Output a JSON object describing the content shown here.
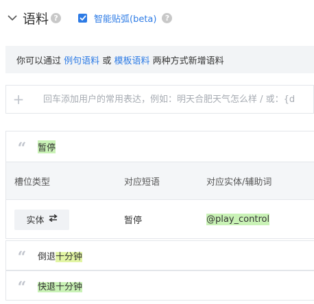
{
  "header": {
    "title": "语料",
    "smart_arc_label": "智能贴弧(beta)",
    "smart_arc_checked": true
  },
  "info": {
    "prefix": "你可以通过",
    "link1": "例句语料",
    "mid": "或",
    "link2": "模板语料",
    "suffix": "两种方式新增语料"
  },
  "add_input": {
    "placeholder": "回车添加用户的常用表达，例如：明天合肥天气怎么样 / 或：{d",
    "value": ""
  },
  "expanded_example": {
    "phrase": "暂停",
    "columns": [
      "槽位类型",
      "对应短语",
      "对应实体/辅助词"
    ],
    "row": {
      "slot_type": "实体",
      "phrase": "暂停",
      "entity": "@play_control"
    }
  },
  "examples": [
    {
      "plain": "倒退",
      "highlight": "十分钟"
    },
    {
      "plain": "",
      "highlight": "快退十分钟"
    }
  ],
  "colors": {
    "accent": "#2d7be5",
    "highlight_green": "#c9f2b6",
    "highlight_yellow": "#e2f5a4",
    "panel_bg": "#f2f4f6"
  }
}
